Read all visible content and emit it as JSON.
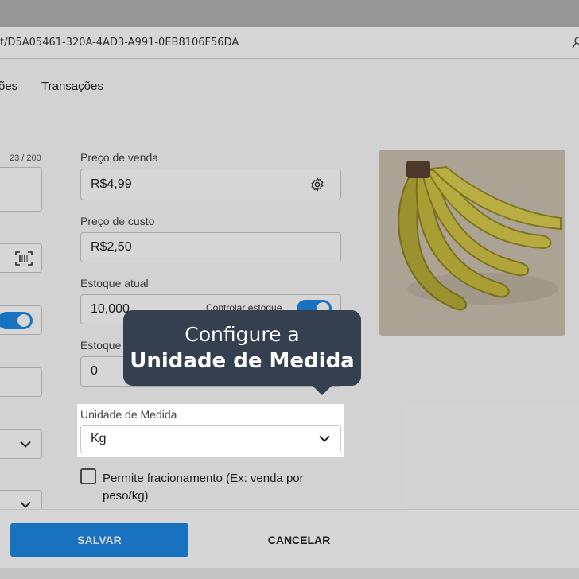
{
  "browser": {
    "url": "t/D5A05461-320A-4AD3-A991-0EB8106F56DA"
  },
  "nav": {
    "tabs": [
      {
        "label": "ões"
      },
      {
        "label": "Transações"
      }
    ]
  },
  "left_column": {
    "counter": "23 / 200"
  },
  "form": {
    "sale_price": {
      "label": "Preço de venda",
      "value": "R$4,99",
      "icon": "gear-icon"
    },
    "cost_price": {
      "label": "Preço de custo",
      "value": "R$2,50"
    },
    "stock": {
      "label": "Estoque atual",
      "value": "10,000",
      "toggle_label": "Controlar estoque",
      "toggle_on": true
    },
    "min_stock": {
      "label": "Estoque",
      "value": "0"
    },
    "unit": {
      "label": "Unidade de Medida",
      "value": "Kg",
      "icon": "chevron-down-icon"
    },
    "fraction": {
      "label": "Permite fracionamento (Ex: venda por peso/kg)",
      "checked": false
    }
  },
  "product_image": {
    "icon": "banana-image"
  },
  "tooltip": {
    "line1": "Configure a",
    "line2": "Unidade de Medida"
  },
  "footer": {
    "save_label": "SALVAR",
    "cancel_label": "CANCELAR"
  },
  "colors": {
    "accent": "#1e88e5",
    "tooltip_bg": "#34404f"
  }
}
